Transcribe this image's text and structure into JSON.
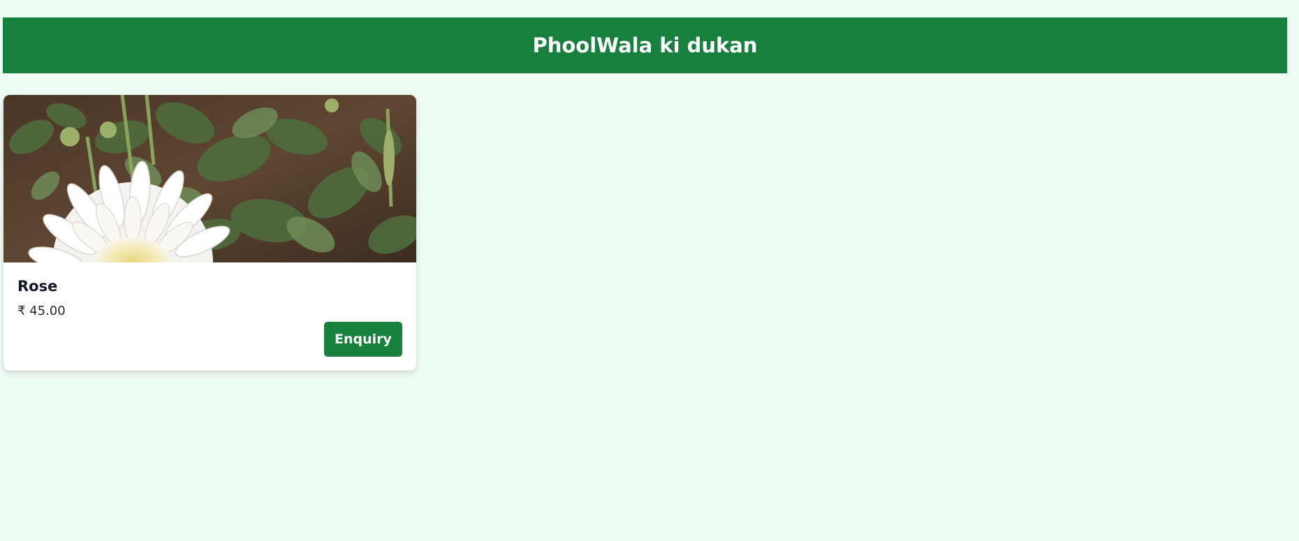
{
  "header": {
    "title": "PhoolWala ki dukan"
  },
  "products": [
    {
      "name": "Rose",
      "price": "₹ 45.00",
      "button_label": "Enquiry",
      "image_alt": "white chrysanthemum flower among green leaves"
    }
  ],
  "colors": {
    "page_background": "#effcf3",
    "header_background": "#16803c",
    "button_background": "#16803c"
  }
}
